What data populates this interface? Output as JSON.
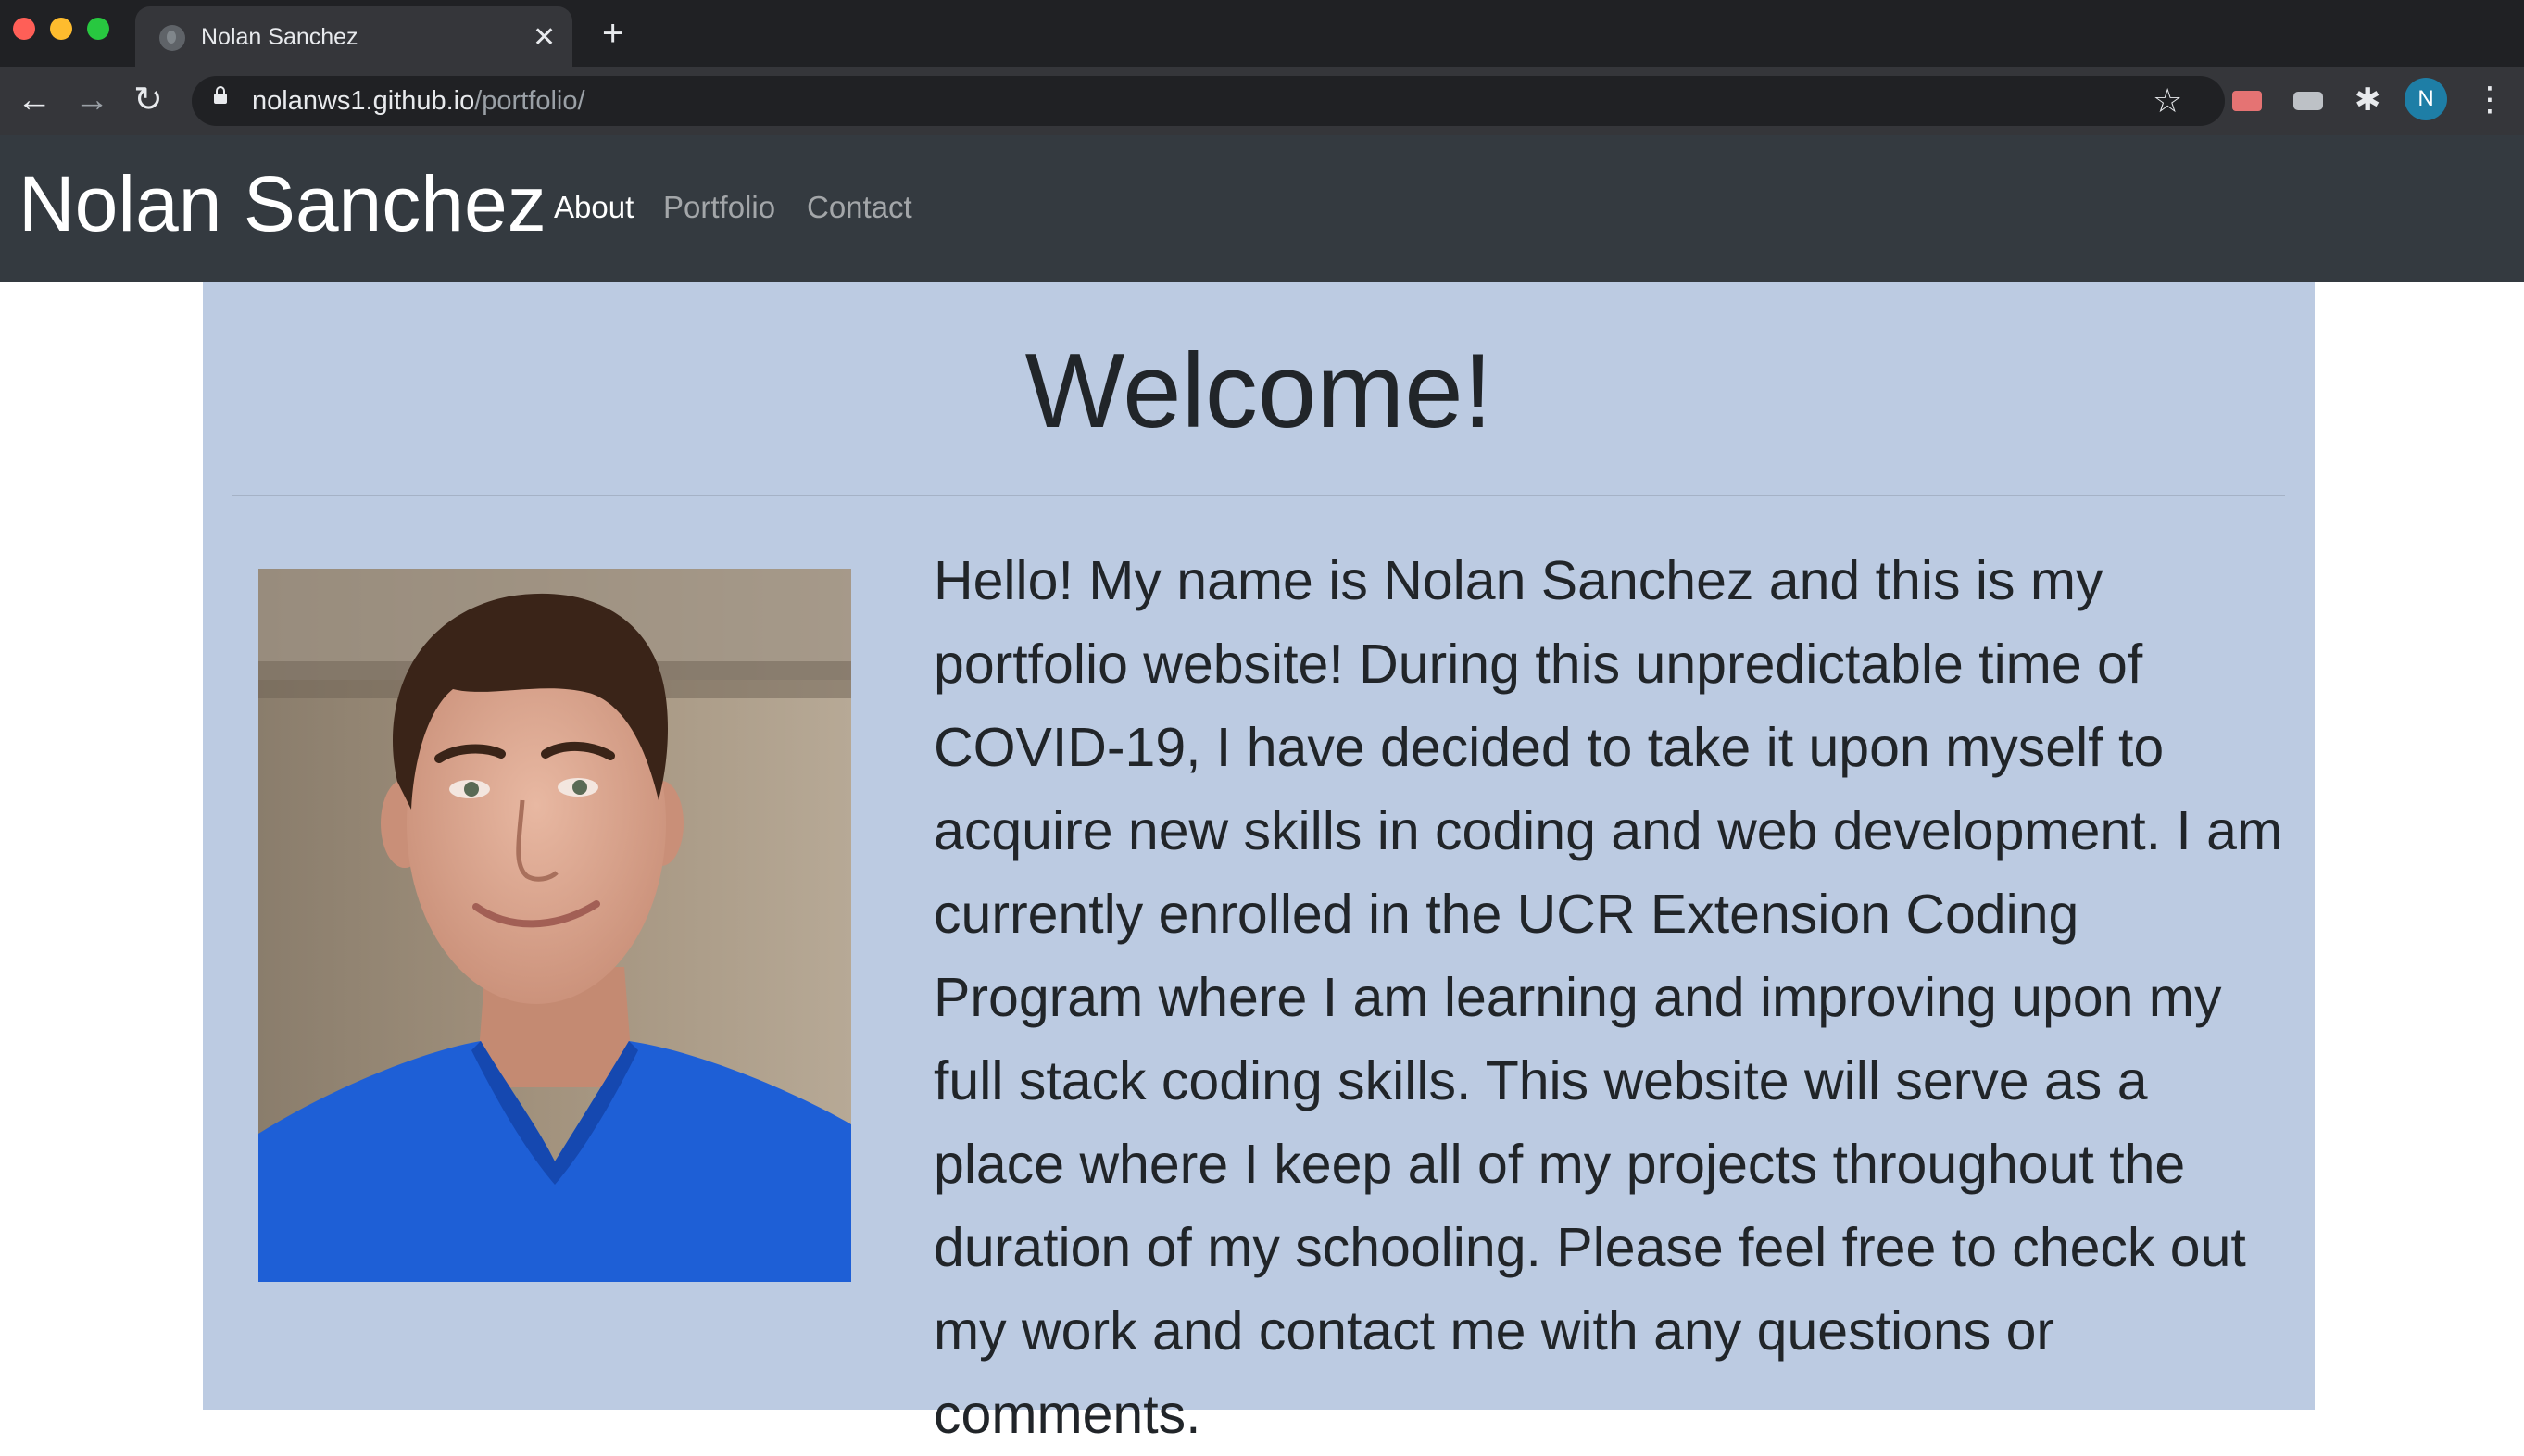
{
  "browser": {
    "tab_title": "Nolan Sanchez",
    "tab_close": "✕",
    "new_tab": "+",
    "back": "←",
    "forward": "→",
    "reload": "↻",
    "url_host": "nolanws1.github.io",
    "url_path": "/portfolio/",
    "star": "☆",
    "puzzle": "✱",
    "profile_initial": "N",
    "menu": "⋮"
  },
  "site": {
    "brand": "Nolan Sanchez",
    "nav": [
      {
        "label": "About",
        "active": true
      },
      {
        "label": "Portfolio",
        "active": false
      },
      {
        "label": "Contact",
        "active": false
      }
    ]
  },
  "main": {
    "heading": "Welcome!",
    "bio": "Hello! My name is Nolan Sanchez and this is my portfolio website! During this unpredictable time of COVID-19, I have decided to take it upon myself to acquire new skills in coding and web development. I am currently enrolled in the UCR Extension Coding Program where I am learning and improving upon my full stack coding skills. This website will serve as a place where I keep all of my projects throughout the duration of my schooling. Please feel free to check out my work and contact me with any questions or comments."
  },
  "colors": {
    "navbar": "#343a40",
    "jumbotron": "#bccbe2",
    "shirt": "#1e5fd6"
  }
}
